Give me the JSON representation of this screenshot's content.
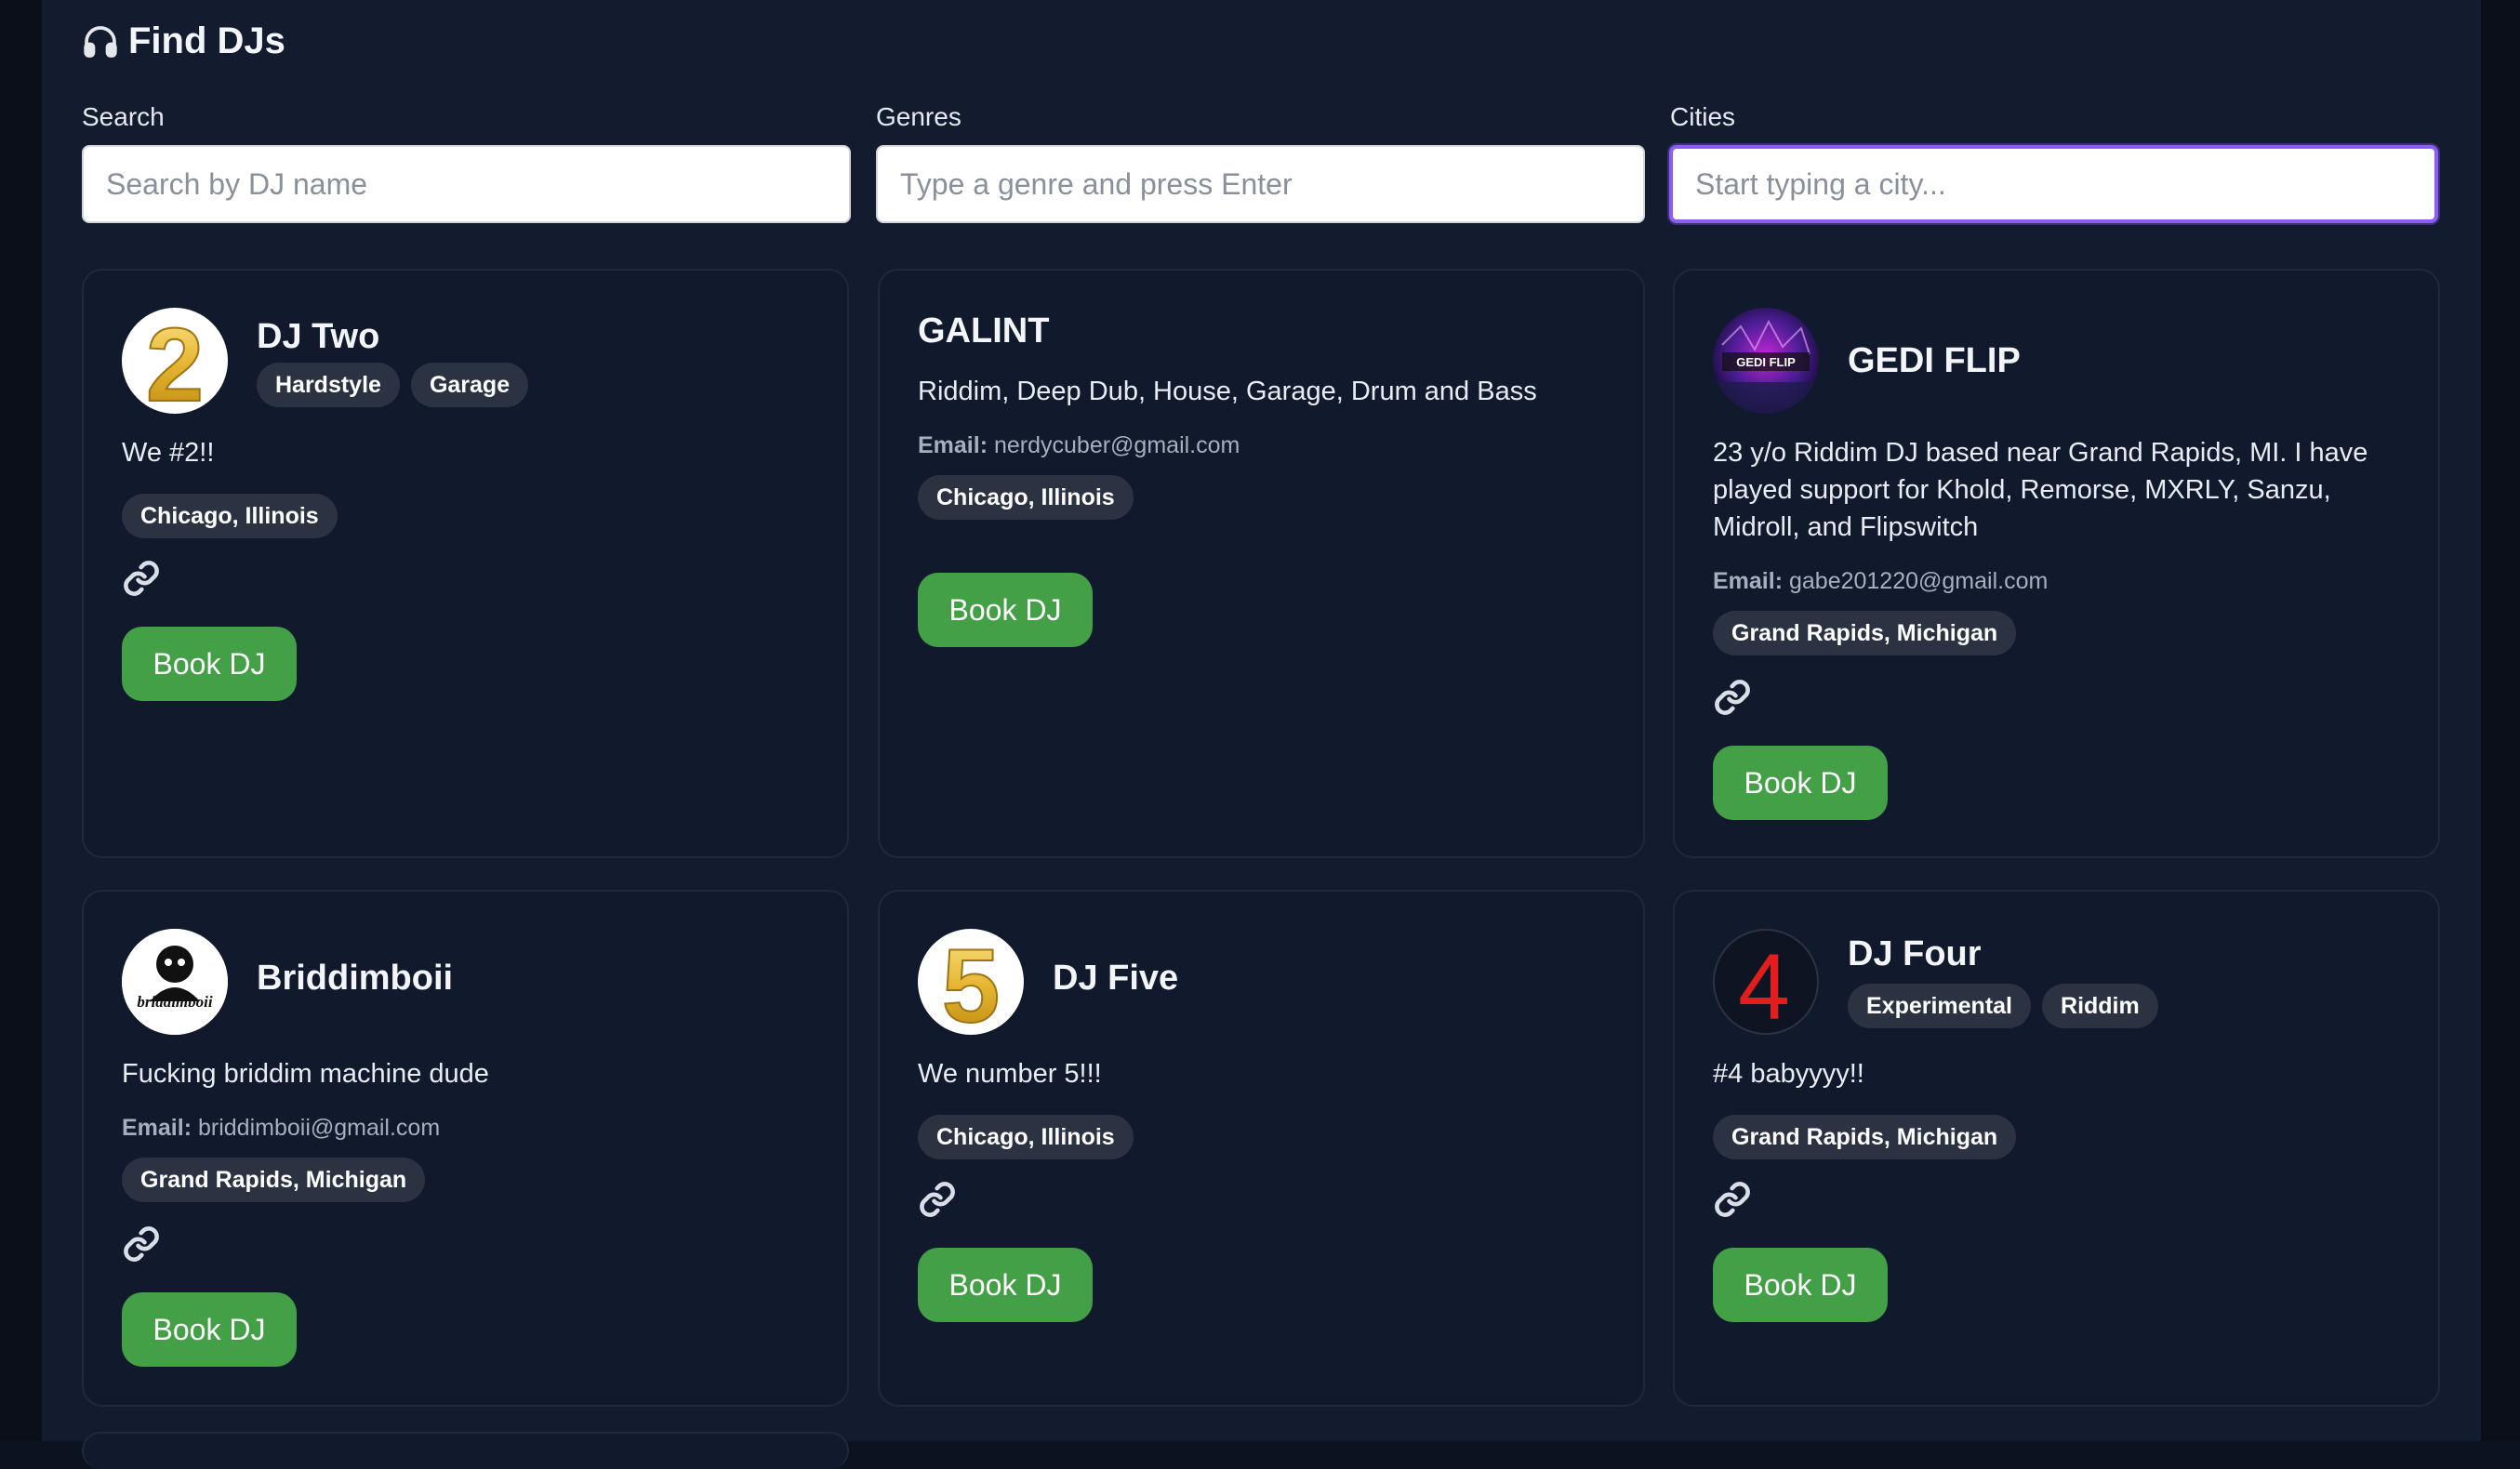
{
  "page": {
    "title": "Find DJs"
  },
  "filters": {
    "search": {
      "label": "Search",
      "placeholder": "Search by DJ name"
    },
    "genres": {
      "label": "Genres",
      "placeholder": "Type a genre and press Enter"
    },
    "cities": {
      "label": "Cities",
      "placeholder": "Start typing a city..."
    }
  },
  "book_label": "Book DJ",
  "email_label": "Email:",
  "colors": {
    "accent_focus": "#8b5cf6",
    "book_button": "#43a047",
    "background": "#131b2f",
    "card": "#111a2c"
  },
  "djs": [
    {
      "name": "DJ Two",
      "genres": [
        "Hardstyle",
        "Garage"
      ],
      "bio": "We #2!!",
      "city": "Chicago, Illinois",
      "avatar_glyph": "2"
    },
    {
      "name": "GALINT",
      "genres_text": "Riddim, Deep Dub, House, Garage, Drum and Bass",
      "email": "nerdycuber@gmail.com",
      "city": "Chicago, Illinois"
    },
    {
      "name": "GEDI FLIP",
      "bio": "23 y/o Riddim DJ based near Grand Rapids, MI. I have played support for Khold, Remorse, MXRLY, Sanzu, Midroll, and Flipswitch",
      "email": "gabe201220@gmail.com",
      "city": "Grand Rapids, Michigan",
      "avatar_logo": "GEDI FLIP"
    },
    {
      "name": "Briddimboii",
      "bio": "Fucking briddim machine dude",
      "email": "briddimboii@gmail.com",
      "city": "Grand Rapids, Michigan",
      "avatar_logo": "briddimboii"
    },
    {
      "name": "DJ Five",
      "bio": "We number 5!!!",
      "city": "Chicago, Illinois",
      "avatar_glyph": "5"
    },
    {
      "name": "DJ Four",
      "genres": [
        "Experimental",
        "Riddim"
      ],
      "bio": "#4 babyyyy!!",
      "city": "Grand Rapids, Michigan",
      "avatar_glyph": "4"
    }
  ]
}
